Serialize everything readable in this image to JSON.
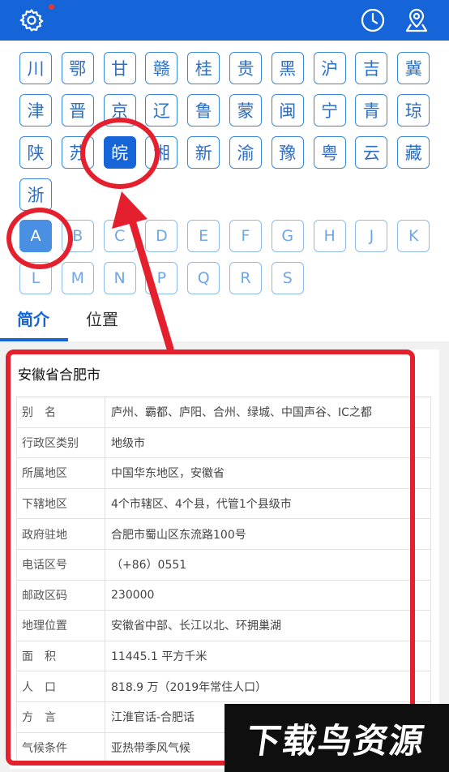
{
  "header": {
    "icons": [
      "gear-icon",
      "clock-icon",
      "location-pin-icon"
    ],
    "accent": "#1565d8",
    "notification_dot_color": "#e53935"
  },
  "provinces": [
    "川",
    "鄂",
    "甘",
    "赣",
    "桂",
    "贵",
    "黑",
    "沪",
    "吉",
    "冀",
    "津",
    "晋",
    "京",
    "辽",
    "鲁",
    "蒙",
    "闽",
    "宁",
    "青",
    "琼",
    "陕",
    "苏",
    "皖",
    "湘",
    "新",
    "渝",
    "豫",
    "粤",
    "云",
    "藏",
    "浙"
  ],
  "selected_province": "皖",
  "letters": [
    "A",
    "B",
    "C",
    "D",
    "E",
    "F",
    "G",
    "H",
    "J",
    "K",
    "L",
    "M",
    "N",
    "P",
    "Q",
    "R",
    "S"
  ],
  "selected_letter": "A",
  "tabs": [
    {
      "label": "简介",
      "active": true
    },
    {
      "label": "位置",
      "active": false
    }
  ],
  "info": {
    "title": "安徽省合肥市",
    "rows": [
      {
        "k": "别　名",
        "v": "庐州、霸都、庐阳、合州、绿城、中国声谷、IC之都"
      },
      {
        "k": "行政区类别",
        "v": "地级市"
      },
      {
        "k": "所属地区",
        "v": "中国华东地区，安徽省"
      },
      {
        "k": "下辖地区",
        "v": "4个市辖区、4个县，代管1个县级市"
      },
      {
        "k": "政府驻地",
        "v": "合肥市蜀山区东流路100号"
      },
      {
        "k": "电话区号",
        "v": "（+86）0551"
      },
      {
        "k": "邮政区码",
        "v": "230000"
      },
      {
        "k": "地理位置",
        "v": "安徽省中部、长江以北、环拥巢湖"
      },
      {
        "k": "面　积",
        "v": "11445.1 平方千米"
      },
      {
        "k": "人　口",
        "v": "818.9 万（2019年常住人口）"
      },
      {
        "k": "方　言",
        "v": "江淮官话-合肥话"
      },
      {
        "k": "气候条件",
        "v": "亚热带季风气候"
      }
    ]
  },
  "annotation_color": "#e5202e",
  "watermark": {
    "text": "下载鸟资源"
  }
}
